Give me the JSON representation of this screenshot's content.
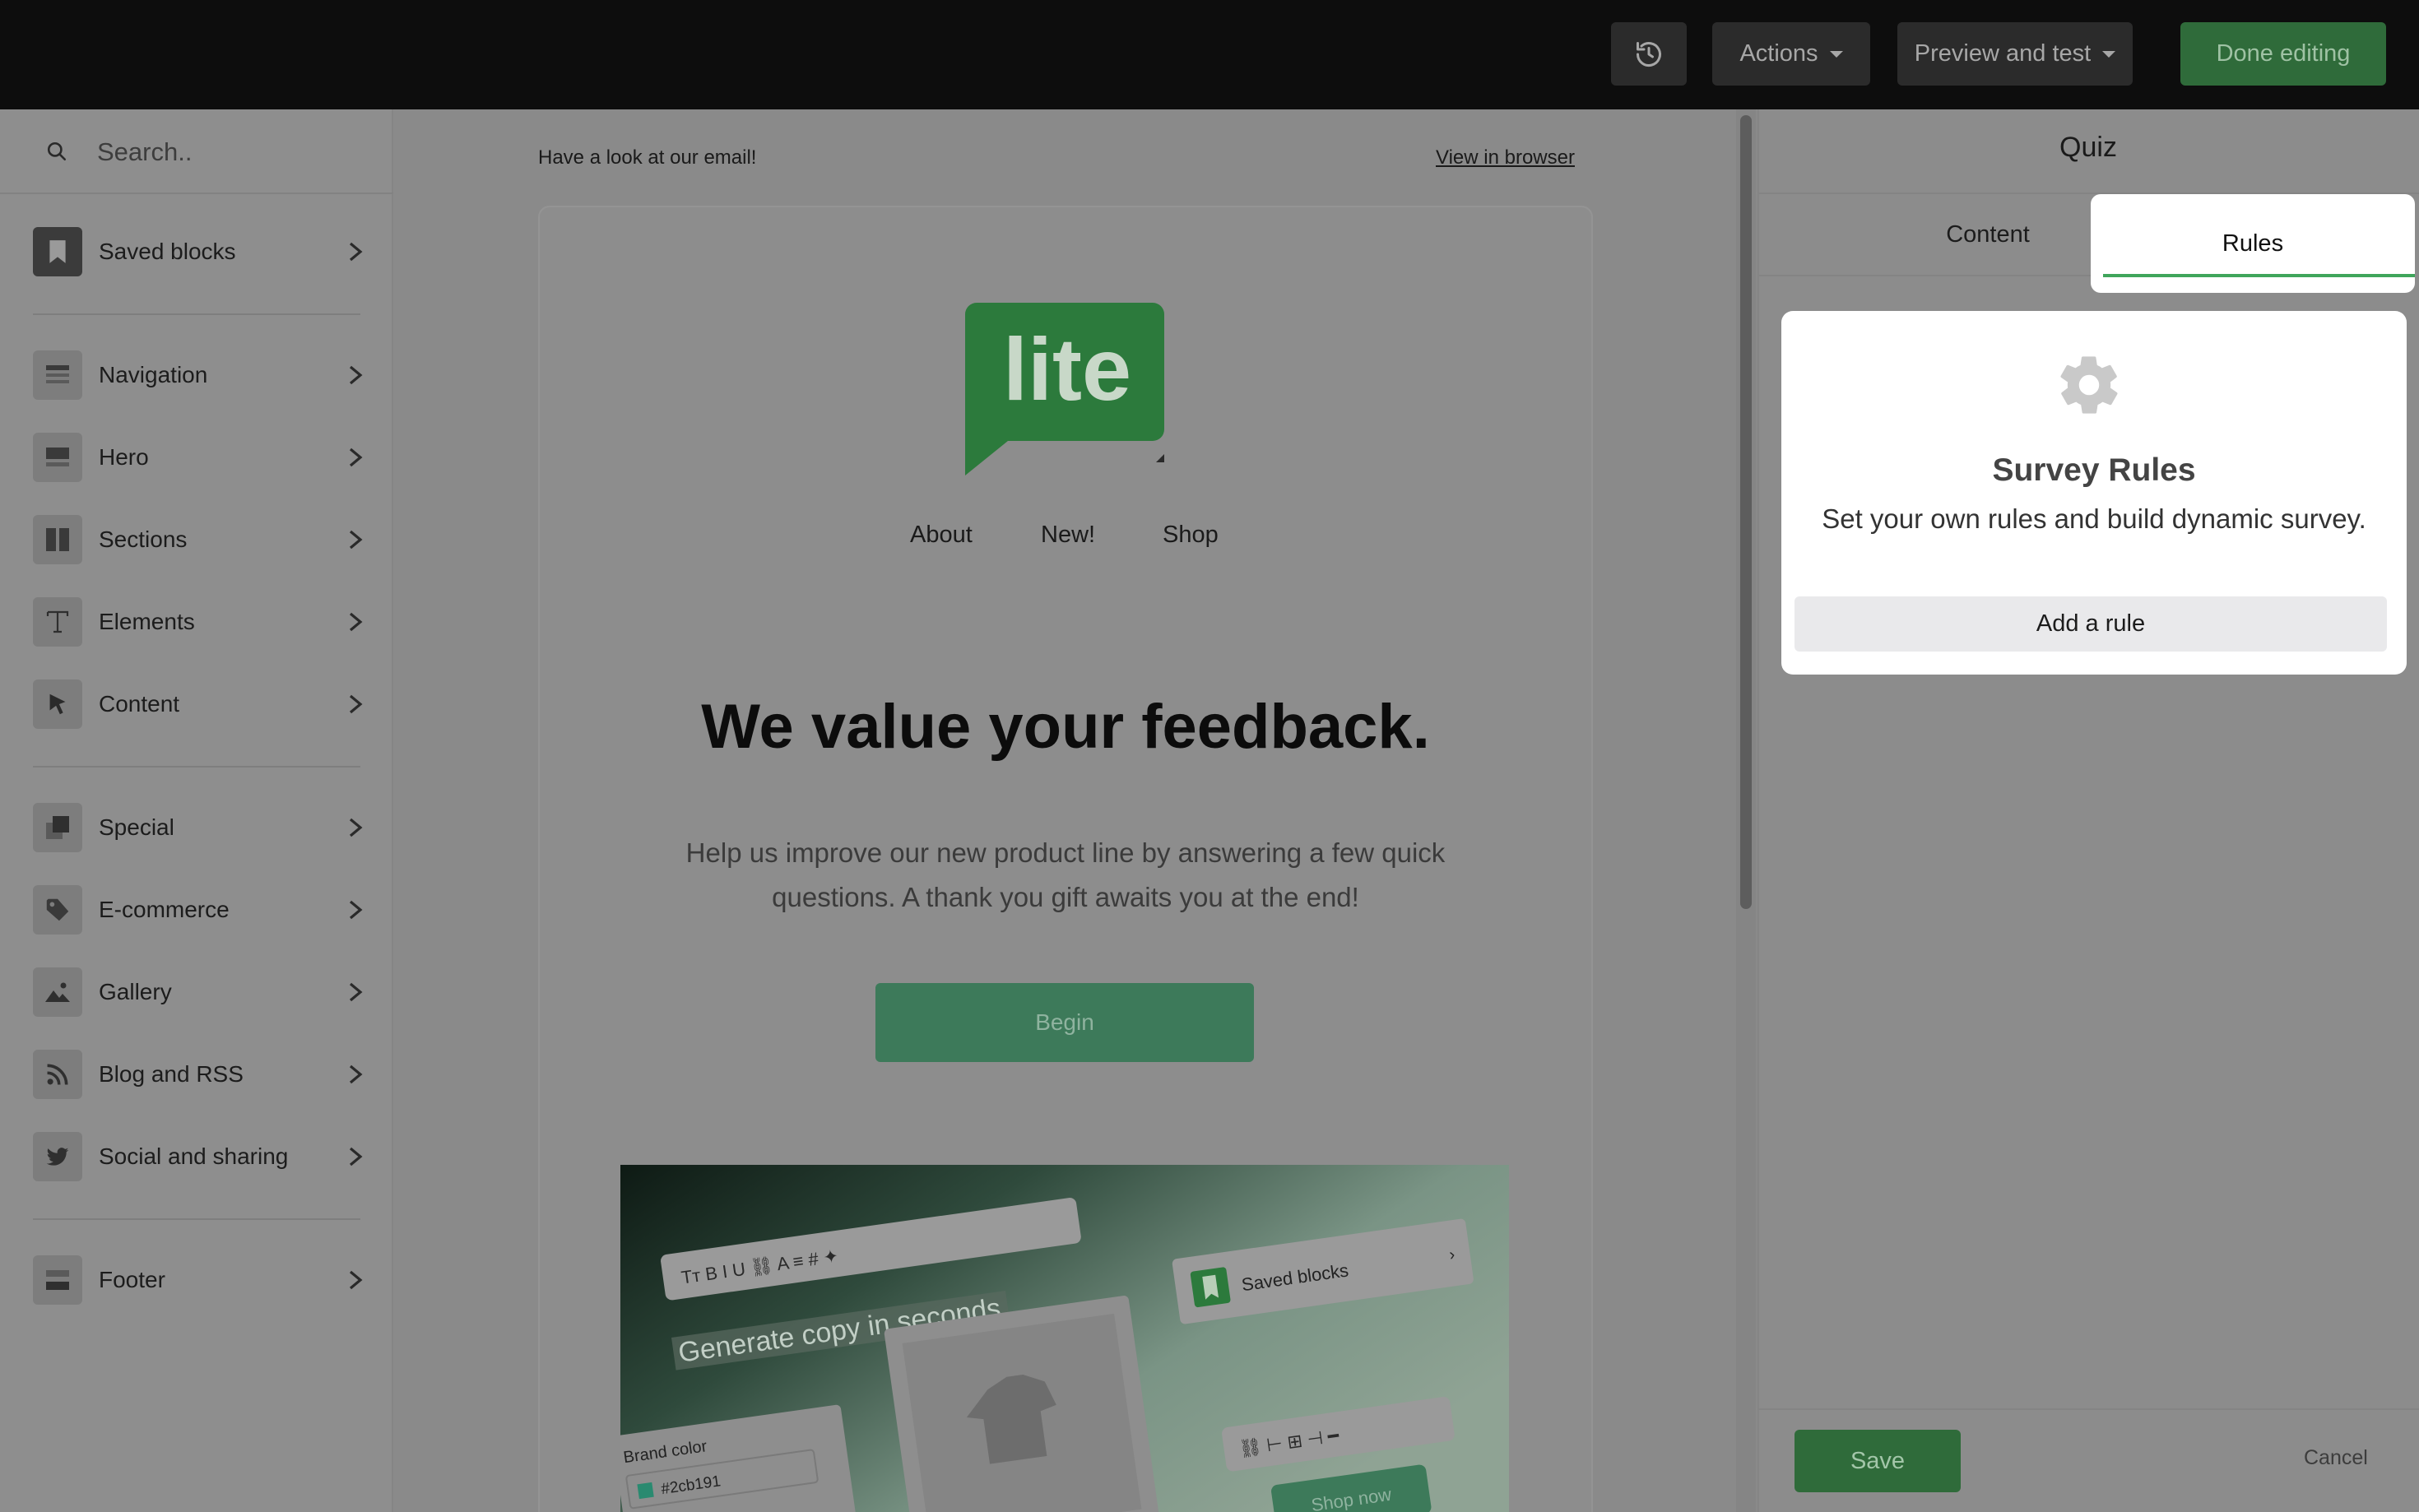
{
  "topbar": {
    "history_icon": "history-icon",
    "actions_label": "Actions",
    "preview_label": "Preview and test",
    "done_label": "Done editing"
  },
  "sidebar": {
    "search_placeholder": "Search..",
    "items": [
      {
        "label": "Saved blocks",
        "icon": "bookmark-icon"
      },
      {
        "label": "Navigation",
        "icon": "navigation-icon"
      },
      {
        "label": "Hero",
        "icon": "hero-icon"
      },
      {
        "label": "Sections",
        "icon": "sections-icon"
      },
      {
        "label": "Elements",
        "icon": "text-icon"
      },
      {
        "label": "Content",
        "icon": "cursor-icon"
      },
      {
        "label": "Special",
        "icon": "special-icon"
      },
      {
        "label": "E-commerce",
        "icon": "tag-icon"
      },
      {
        "label": "Gallery",
        "icon": "image-icon"
      },
      {
        "label": "Blog and RSS",
        "icon": "rss-icon"
      },
      {
        "label": "Social and sharing",
        "icon": "twitter-icon"
      },
      {
        "label": "Footer",
        "icon": "footer-icon"
      }
    ]
  },
  "email": {
    "preheader": "Have a look at our email!",
    "view_in_browser": "View in browser",
    "logo_text": "lite",
    "nav": [
      "About",
      "New!",
      "Shop"
    ],
    "headline": "We value your feedback.",
    "subtext": "Help us improve our new product line by answering a few quick questions. A thank you gift awaits you at the end!",
    "button_label": "Begin",
    "hero_image": {
      "caption": "Generate copy in seconds",
      "saved_blocks": "Saved blocks",
      "brand_color_label": "Brand color",
      "brand_color_value": "#2cb191",
      "shop_now": "Shop now"
    }
  },
  "panel": {
    "title": "Quiz",
    "tabs": [
      "Content",
      "Rules"
    ],
    "active_tab": "Rules",
    "rules_title": "Survey Rules",
    "rules_desc": "Set your own rules and build dynamic survey.",
    "add_rule_label": "Add a rule",
    "save_label": "Save",
    "cancel_label": "Cancel"
  },
  "colors": {
    "brand_green": "#2f6b3a",
    "tab_underline": "#3fa55b",
    "topbar_bg": "#0d0d0d"
  }
}
